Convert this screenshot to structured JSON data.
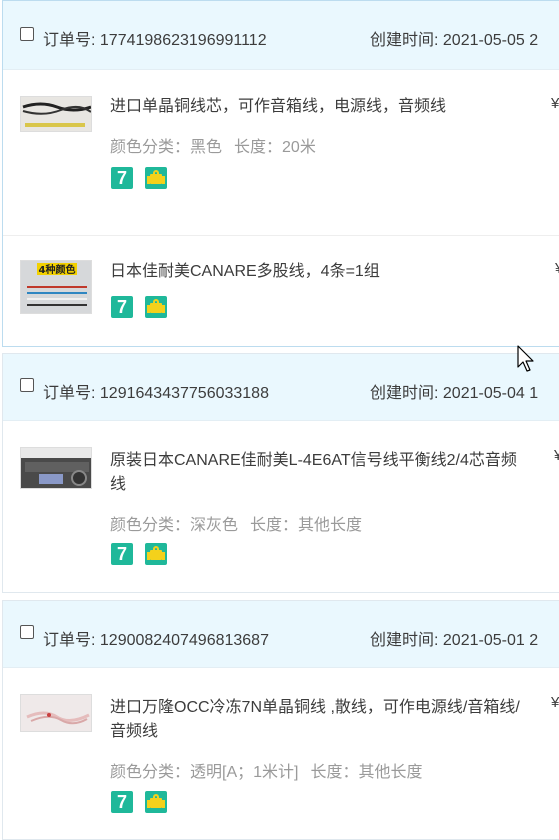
{
  "orders": [
    {
      "order_label": "订单号:",
      "order_no": "1774198623196991112",
      "created_label": "创建时间:",
      "created_value": "2021-05-05 2",
      "items": [
        {
          "title": "进口单晶铜线芯，可作音箱线，电源线，音频线",
          "spec": "颜色分类：黑色",
          "spec2": "长度：20米",
          "price": "¥"
        },
        {
          "title": "日本佳耐美CANARE多股线，4条=1组",
          "thumb_label": "4种颜色",
          "price": "¥"
        }
      ]
    },
    {
      "order_label": "订单号:",
      "order_no": "1291643437756033188",
      "created_label": "创建时间:",
      "created_value": "2021-05-04 1",
      "items": [
        {
          "title": "原装日本CANARE佳耐美L-4E6AT信号线平衡线2/4芯音频线",
          "spec": "颜色分类：深灰色",
          "spec2": "长度：其他长度",
          "price": "¥"
        }
      ]
    },
    {
      "order_label": "订单号:",
      "order_no": "1290082407496813687",
      "created_label": "创建时间:",
      "created_value": "2021-05-01 2",
      "items": [
        {
          "title": "进口万隆OCC冷冻7N单晶铜线 ,散线，可作电源线/音箱线/音频线",
          "spec": "颜色分类：透明[A；1米计]",
          "spec2": "长度：其他长度",
          "price": "¥"
        }
      ]
    }
  ],
  "service_icons": {
    "seven_day": "7",
    "seven_day_icon": "seven-day-return-icon",
    "bag_icon": "shopping-bag-icon"
  },
  "colors": {
    "header_bg": "#eaf8fe",
    "icon_green": "#1fb89a",
    "icon_yellow": "#f4d11b",
    "spec_gray": "#9a9a9a"
  }
}
